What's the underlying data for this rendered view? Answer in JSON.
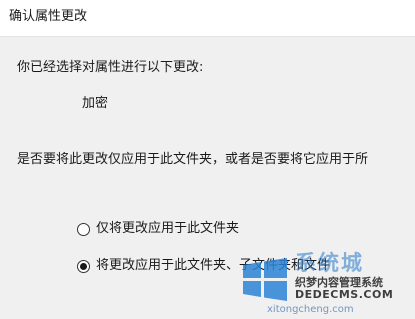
{
  "window": {
    "title": "确认属性更改"
  },
  "dialog": {
    "intro": "你已经选择对属性进行以下更改:",
    "attribute_change": "加密",
    "question": "是否要将此更改仅应用于此文件夹，或者是否要将它应用于所",
    "options": [
      {
        "label": "仅将更改应用于此文件夹",
        "selected": false
      },
      {
        "label": "将更改应用于此文件夹、子文件夹和文件",
        "selected": true
      }
    ]
  },
  "watermark": {
    "brand": "系统城",
    "line1": "织梦内容管理系统",
    "line2": "DEDECMS.COM",
    "url": "xitongcheng.com",
    "colors": {
      "logo_blue": "#2a82d6"
    }
  }
}
